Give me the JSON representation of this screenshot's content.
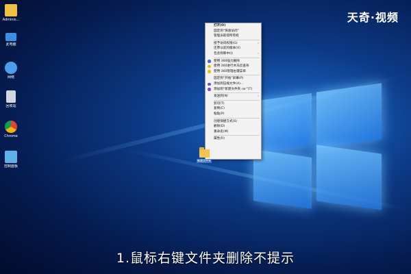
{
  "desktop_icons": [
    {
      "name": "admin-folder",
      "label": "Adminis..."
    },
    {
      "name": "computer",
      "label": "此电脑"
    },
    {
      "name": "network",
      "label": "网络"
    },
    {
      "name": "recycle-bin",
      "label": "回收站"
    },
    {
      "name": "chrome",
      "label": "Chrome"
    },
    {
      "name": "control-panel",
      "label": "控制面板"
    }
  ],
  "watermark": "天奇·视频",
  "context_menu": [
    {
      "label": "打开(O)",
      "bold": true
    },
    {
      "label": "固定到“快速访问”"
    },
    {
      "label": "管理员取得所有权"
    },
    {
      "sep": true
    },
    {
      "label": "授予访问权限(G)",
      "arrow": true
    },
    {
      "label": "还原以前的版本(V)"
    },
    {
      "label": "包含到库中(I)",
      "arrow": true
    },
    {
      "sep": true
    },
    {
      "label": "使用 360强力删除",
      "icon": "#3a6fd8"
    },
    {
      "label": "使用 360进行木马云查杀",
      "icon": "#e6c300"
    },
    {
      "label": "使用 360管理右键菜单",
      "icon": "#e6c300"
    },
    {
      "sep": true
    },
    {
      "label": "固定到“开始”屏幕(P)"
    },
    {
      "label": "添加到压缩文件(A)...",
      "icon": "#7a4bd0"
    },
    {
      "label": "添加到“新建文件夹.rar”(T)",
      "icon": "#7a4bd0"
    },
    {
      "sep": true
    },
    {
      "label": "发送到(N)",
      "arrow": true
    },
    {
      "sep": true
    },
    {
      "label": "剪切(T)"
    },
    {
      "label": "复制(C)"
    },
    {
      "label": "粘贴(P)"
    },
    {
      "sep": true
    },
    {
      "label": "创建快捷方式(S)"
    },
    {
      "label": "删除(D)"
    },
    {
      "label": "重命名(M)"
    },
    {
      "sep": true
    },
    {
      "label": "属性(R)"
    }
  ],
  "folder": {
    "label": "新建文件夹"
  },
  "subtitle": "1.鼠标右键文件夹删除不提示"
}
